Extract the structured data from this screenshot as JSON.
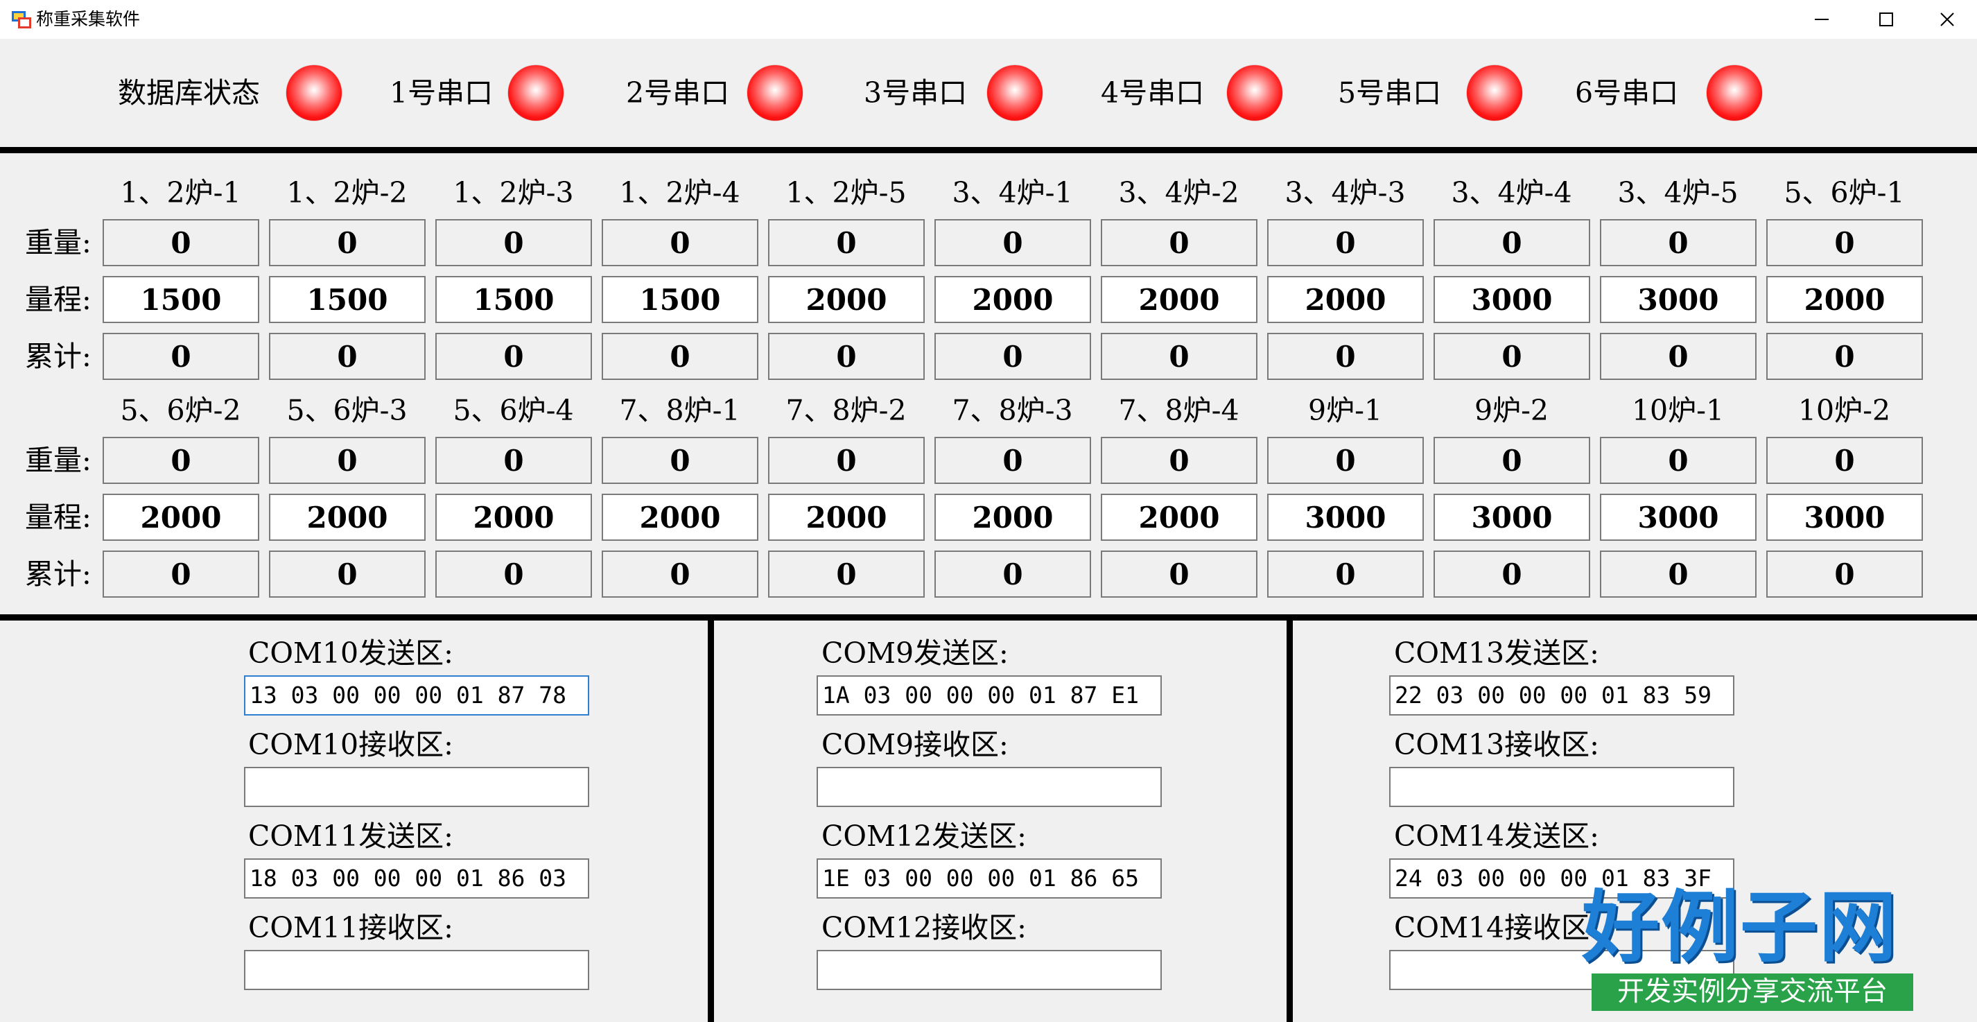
{
  "window": {
    "title": "称重采集软件"
  },
  "status_row": [
    {
      "label": "数据库状态",
      "led_color": "#ff1414"
    },
    {
      "label": "1号串口",
      "led_color": "#ff1414"
    },
    {
      "label": "2号串口",
      "led_color": "#ff1414"
    },
    {
      "label": "3号串口",
      "led_color": "#ff1414"
    },
    {
      "label": "4号串口",
      "led_color": "#ff1414"
    },
    {
      "label": "5号串口",
      "led_color": "#ff1414"
    },
    {
      "label": "6号串口",
      "led_color": "#ff1414"
    }
  ],
  "row_labels": {
    "weight": "重量:",
    "range": "量程:",
    "total": "累计:"
  },
  "grid": [
    {
      "headers": [
        "1、2炉-1",
        "1、2炉-2",
        "1、2炉-3",
        "1、2炉-4",
        "1、2炉-5",
        "3、4炉-1",
        "3、4炉-2",
        "3、4炉-3",
        "3、4炉-4",
        "3、4炉-5",
        "5、6炉-1"
      ],
      "weight": [
        "0",
        "0",
        "0",
        "0",
        "0",
        "0",
        "0",
        "0",
        "0",
        "0",
        "0"
      ],
      "range": [
        "1500",
        "1500",
        "1500",
        "1500",
        "2000",
        "2000",
        "2000",
        "2000",
        "3000",
        "3000",
        "2000"
      ],
      "total": [
        "0",
        "0",
        "0",
        "0",
        "0",
        "0",
        "0",
        "0",
        "0",
        "0",
        "0"
      ]
    },
    {
      "headers": [
        "5、6炉-2",
        "5、6炉-3",
        "5、6炉-4",
        "7、8炉-1",
        "7、8炉-2",
        "7、8炉-3",
        "7、8炉-4",
        "9炉-1",
        "9炉-2",
        "10炉-1",
        "10炉-2"
      ],
      "weight": [
        "0",
        "0",
        "0",
        "0",
        "0",
        "0",
        "0",
        "0",
        "0",
        "0",
        "0"
      ],
      "range": [
        "2000",
        "2000",
        "2000",
        "2000",
        "2000",
        "2000",
        "2000",
        "3000",
        "3000",
        "3000",
        "3000"
      ],
      "total": [
        "0",
        "0",
        "0",
        "0",
        "0",
        "0",
        "0",
        "0",
        "0",
        "0",
        "0"
      ]
    }
  ],
  "com_panels": [
    {
      "send_label": "COM10发送区:",
      "send_value": "13 03 00 00 00 01 87 78",
      "recv_label": "COM10接收区:",
      "recv_value": ""
    },
    {
      "send_label": "COM9发送区:",
      "send_value": "1A 03 00 00 00 01 87 E1",
      "recv_label": "COM9接收区:",
      "recv_value": ""
    },
    {
      "send_label": "COM13发送区:",
      "send_value": "22 03 00 00 00 01 83 59",
      "recv_label": "COM13接收区:",
      "recv_value": ""
    },
    {
      "send_label": "COM11发送区:",
      "send_value": "18 03 00 00 00 01 86 03",
      "recv_label": "COM11接收区:",
      "recv_value": ""
    },
    {
      "send_label": "COM12发送区:",
      "send_value": "1E 03 00 00 00 01 86 65",
      "recv_label": "COM12接收区:",
      "recv_value": ""
    },
    {
      "send_label": "COM14发送区:",
      "send_value": "24 03 00 00 00 01 83 3F",
      "recv_label": "COM14接收区:",
      "recv_value": ""
    }
  ],
  "watermark": {
    "logo": "好例子网",
    "tagline": "开发实例分享交流平台"
  }
}
